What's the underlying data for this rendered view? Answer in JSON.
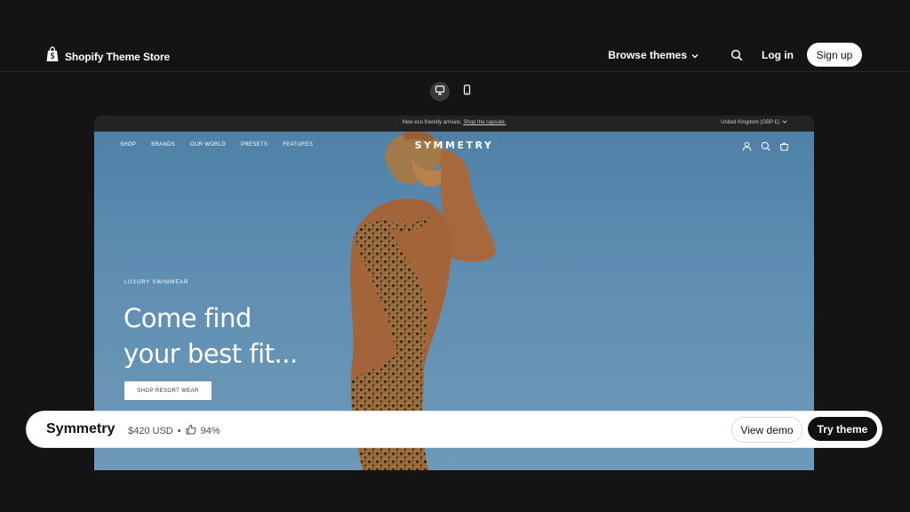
{
  "header": {
    "brand": "Shopify Theme Store",
    "browse_label": "Browse themes",
    "login_label": "Log in",
    "signup_label": "Sign up"
  },
  "preview": {
    "announcement": "New eco friendly arrivals.",
    "announcement_link": "Shop the capsule.",
    "region": "United Kingdom (GBP £)",
    "nav": [
      "SHOP",
      "BRANDS",
      "OUR WORLD",
      "PRESETS",
      "FEATURES"
    ],
    "logo": "SYMMETRY",
    "eyebrow": "LUXURY SWIMWEAR",
    "headline_line1": "Come find",
    "headline_line2": "your best fit...",
    "cta": "SHOP RESORT WEAR"
  },
  "theme_bar": {
    "name": "Symmetry",
    "price": "$420 USD",
    "separator": "•",
    "rating": "94%",
    "view_demo_label": "View demo",
    "try_theme_label": "Try theme"
  },
  "colors": {
    "page_bg": "#141414",
    "sky": "#5f8eb1",
    "button_dark": "#111111"
  }
}
